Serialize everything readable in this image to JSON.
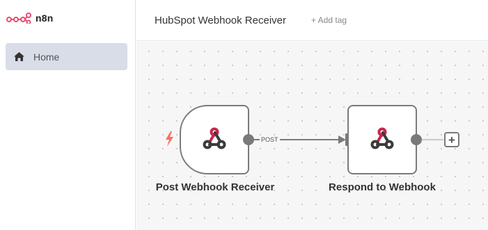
{
  "app": {
    "logo_text": "n8n",
    "brand_color": "#ea4b71"
  },
  "sidebar": {
    "items": [
      {
        "label": "Home",
        "icon": "home-icon"
      }
    ]
  },
  "header": {
    "title": "HubSpot Webhook Receiver",
    "add_tag_label": "+ Add tag"
  },
  "canvas": {
    "nodes": [
      {
        "name": "Post Webhook Receiver",
        "type": "trigger",
        "icon": "webhook-icon"
      },
      {
        "name": "Respond to Webhook",
        "type": "action",
        "icon": "webhook-icon"
      }
    ],
    "connection": {
      "label": "POST"
    },
    "add_node_symbol": "+",
    "colors": {
      "node_border": "#7a7a7a",
      "trigger_bolt": "#ff6d5a",
      "webhook_red": "#c8264d",
      "webhook_dark": "#3b3b3b"
    }
  }
}
